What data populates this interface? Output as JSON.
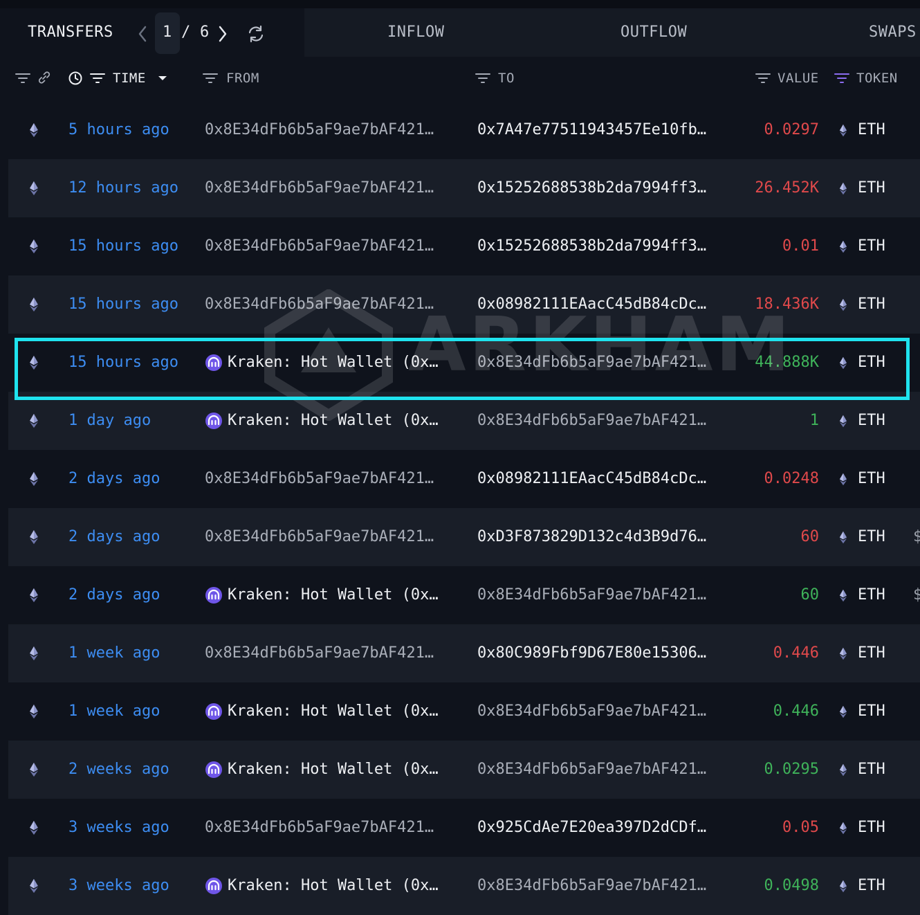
{
  "tabs": {
    "transfers": "TRANSFERS",
    "inflow": "INFLOW",
    "outflow": "OUTFLOW",
    "swaps": "SWAPS"
  },
  "pager": {
    "current": "1",
    "separator": "/",
    "total": "6"
  },
  "columns": {
    "time": "TIME",
    "from": "FROM",
    "to": "TO",
    "value": "VALUE",
    "token": "TOKEN"
  },
  "watermark": "ARKHAM",
  "colors": {
    "accent_blue": "#3d8df2",
    "outflow_red": "#e0494b",
    "inflow_green": "#3fb35a",
    "highlight_cyan": "#1fe3ee",
    "kraken_purple": "#6f56e8",
    "token_filter_purple": "#8b6cf0"
  },
  "rows": [
    {
      "time": "5 hours ago",
      "from": "0x8E34dFb6b5aF9ae7bAF421…",
      "from_entity": false,
      "to": "0x7A47e77511943457Ee10fb…",
      "to_dim": false,
      "value": "0.0297",
      "direction": "out",
      "token": "ETH"
    },
    {
      "time": "12 hours ago",
      "from": "0x8E34dFb6b5aF9ae7bAF421…",
      "from_entity": false,
      "to": "0x15252688538b2da7994ff3…",
      "to_dim": false,
      "value": "26.452K",
      "direction": "out",
      "token": "ETH"
    },
    {
      "time": "15 hours ago",
      "from": "0x8E34dFb6b5aF9ae7bAF421…",
      "from_entity": false,
      "to": "0x15252688538b2da7994ff3…",
      "to_dim": false,
      "value": "0.01",
      "direction": "out",
      "token": "ETH"
    },
    {
      "time": "15 hours ago",
      "from": "0x8E34dFb6b5aF9ae7bAF421…",
      "from_entity": false,
      "to": "0x08982111EAacC45dB84cDc…",
      "to_dim": false,
      "value": "18.436K",
      "direction": "out",
      "token": "ETH"
    },
    {
      "time": "15 hours ago",
      "from": "Kraken: Hot Wallet (0x…",
      "from_entity": true,
      "to": "0x8E34dFb6b5aF9ae7bAF421…",
      "to_dim": true,
      "value": "44.888K",
      "direction": "in",
      "token": "ETH"
    },
    {
      "time": "1 day ago",
      "from": "Kraken: Hot Wallet (0x…",
      "from_entity": true,
      "to": "0x8E34dFb6b5aF9ae7bAF421…",
      "to_dim": true,
      "value": "1",
      "direction": "in",
      "token": "ETH"
    },
    {
      "time": "2 days ago",
      "from": "0x8E34dFb6b5aF9ae7bAF421…",
      "from_entity": false,
      "to": "0x08982111EAacC45dB84cDc…",
      "to_dim": false,
      "value": "0.0248",
      "direction": "out",
      "token": "ETH"
    },
    {
      "time": "2 days ago",
      "from": "0x8E34dFb6b5aF9ae7bAF421…",
      "from_entity": false,
      "to": "0xD3F873829D132c4d3B9d76…",
      "to_dim": false,
      "value": "60",
      "direction": "out",
      "token": "ETH",
      "edge": "$"
    },
    {
      "time": "2 days ago",
      "from": "Kraken: Hot Wallet (0x…",
      "from_entity": true,
      "to": "0x8E34dFb6b5aF9ae7bAF421…",
      "to_dim": true,
      "value": "60",
      "direction": "in",
      "token": "ETH",
      "edge": "$"
    },
    {
      "time": "1 week ago",
      "from": "0x8E34dFb6b5aF9ae7bAF421…",
      "from_entity": false,
      "to": "0x80C989Fbf9D67E80e15306…",
      "to_dim": false,
      "value": "0.446",
      "direction": "out",
      "token": "ETH"
    },
    {
      "time": "1 week ago",
      "from": "Kraken: Hot Wallet (0x…",
      "from_entity": true,
      "to": "0x8E34dFb6b5aF9ae7bAF421…",
      "to_dim": true,
      "value": "0.446",
      "direction": "in",
      "token": "ETH"
    },
    {
      "time": "2 weeks ago",
      "from": "Kraken: Hot Wallet (0x…",
      "from_entity": true,
      "to": "0x8E34dFb6b5aF9ae7bAF421…",
      "to_dim": true,
      "value": "0.0295",
      "direction": "in",
      "token": "ETH"
    },
    {
      "time": "3 weeks ago",
      "from": "0x8E34dFb6b5aF9ae7bAF421…",
      "from_entity": false,
      "to": "0x925CdAe7E20ea397D2dCDf…",
      "to_dim": false,
      "value": "0.05",
      "direction": "out",
      "token": "ETH"
    },
    {
      "time": "3 weeks ago",
      "from": "Kraken: Hot Wallet (0x…",
      "from_entity": true,
      "to": "0x8E34dFb6b5aF9ae7bAF421…",
      "to_dim": true,
      "value": "0.0498",
      "direction": "in",
      "token": "ETH"
    }
  ],
  "highlighted_row": 4
}
